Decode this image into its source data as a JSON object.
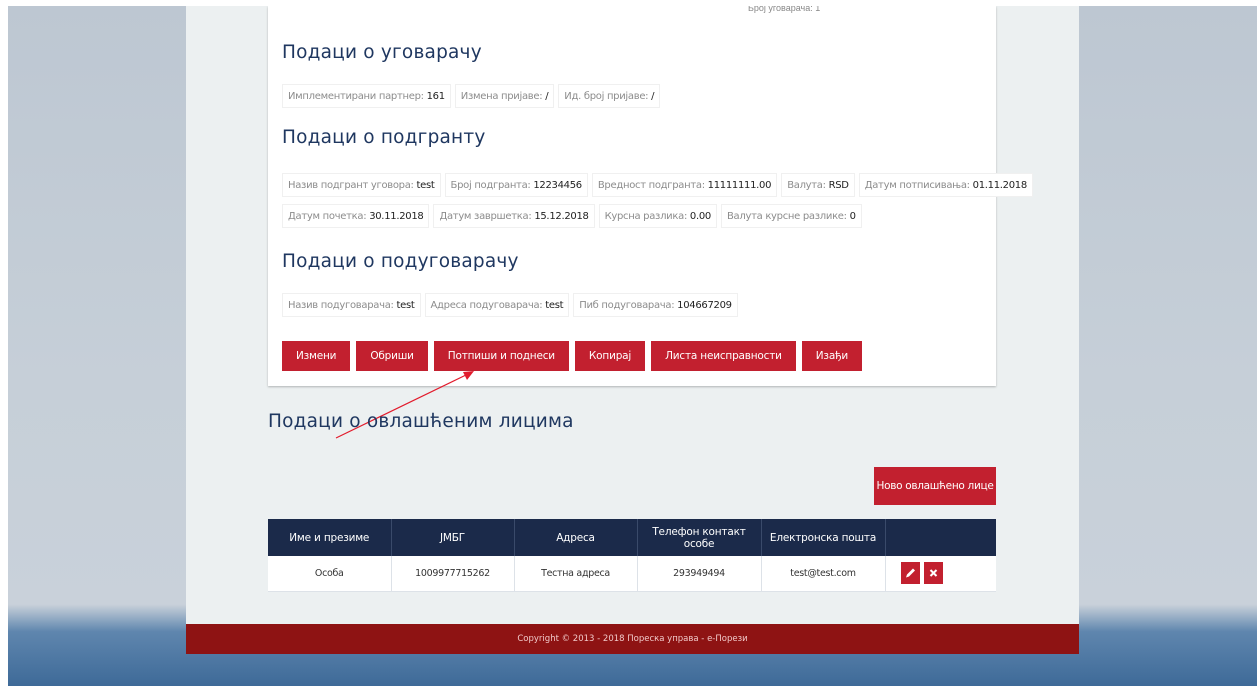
{
  "top_fragment": "Број уговарача: 1",
  "contractor": {
    "title": "Подаци о уговарачу",
    "fields": [
      {
        "label": "Имплементирани партнер:",
        "value": "161"
      },
      {
        "label": "Измена пријаве:",
        "value": "/"
      },
      {
        "label": "Ид. број пријаве:",
        "value": "/"
      }
    ]
  },
  "subgrant": {
    "title": "Подаци о подгранту",
    "row1": [
      {
        "label": "Назив подгрант уговора:",
        "value": "test"
      },
      {
        "label": "Број подгранта:",
        "value": "12234456"
      },
      {
        "label": "Вредност подгранта:",
        "value": "11111111.00"
      },
      {
        "label": "Валута:",
        "value": "RSD"
      },
      {
        "label": "Датум потписивања:",
        "value": "01.11.2018"
      }
    ],
    "row2": [
      {
        "label": "Датум почетка:",
        "value": "30.11.2018"
      },
      {
        "label": "Датум завршетка:",
        "value": "15.12.2018"
      },
      {
        "label": "Курсна разлика:",
        "value": "0.00"
      },
      {
        "label": "Валута курсне разлике:",
        "value": "0"
      }
    ]
  },
  "subcontractor": {
    "title": "Подаци о подуговарачу",
    "fields": [
      {
        "label": "Назив подуговарача:",
        "value": "test"
      },
      {
        "label": "Адреса подуговарача:",
        "value": "test"
      },
      {
        "label": "Пиб подуговарача:",
        "value": "104667209"
      }
    ]
  },
  "actions": {
    "edit": "Измени",
    "delete": "Обриши",
    "sign_submit": "Потпиши и поднеси",
    "copy": "Копирај",
    "defects_list": "Листа неисправности",
    "exit": "Изађи"
  },
  "authorized": {
    "title": "Подаци о овлашћеним лицима",
    "new_button": "Ново овлашћено лице",
    "columns": [
      "Име и презиме",
      "ЈМБГ",
      "Адреса",
      "Телефон контакт особе",
      "Електронска пошта",
      ""
    ],
    "rows": [
      {
        "name": "Особа",
        "jmbg": "1009977715262",
        "address": "Тестна адреса",
        "phone": "293949494",
        "email": "test@test.com"
      }
    ]
  },
  "footer": "Copyright © 2013 - 2018 Пореска управа - е-Порези",
  "colors": {
    "accent": "#c2202f",
    "header": "#1b2a4a",
    "title": "#1f3760",
    "footer": "#8e1313"
  }
}
